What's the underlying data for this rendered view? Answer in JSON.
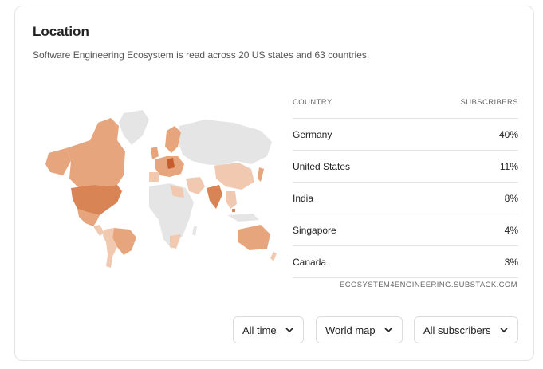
{
  "card": {
    "title": "Location",
    "subtitle": "Software Engineering Ecosystem is read across 20 US states and 63 countries."
  },
  "table": {
    "col_country": "COUNTRY",
    "col_subscribers": "SUBSCRIBERS",
    "rows": [
      {
        "country": "Germany",
        "share": "40%"
      },
      {
        "country": "United States",
        "share": "11%"
      },
      {
        "country": "India",
        "share": "8%"
      },
      {
        "country": "Singapore",
        "share": "4%"
      },
      {
        "country": "Canada",
        "share": "3%"
      }
    ],
    "source": "ECOSYSTEM4ENGINEERING.SUBSTACK.COM"
  },
  "filters": {
    "time": "All time",
    "view": "World map",
    "audience": "All subscribers"
  },
  "colors": {
    "map_base": "#e5e5e5",
    "shade_light": "#f1c9b0",
    "shade_mid": "#e7a57d",
    "shade_strong": "#d98454",
    "shade_darkest": "#c65d2e"
  }
}
